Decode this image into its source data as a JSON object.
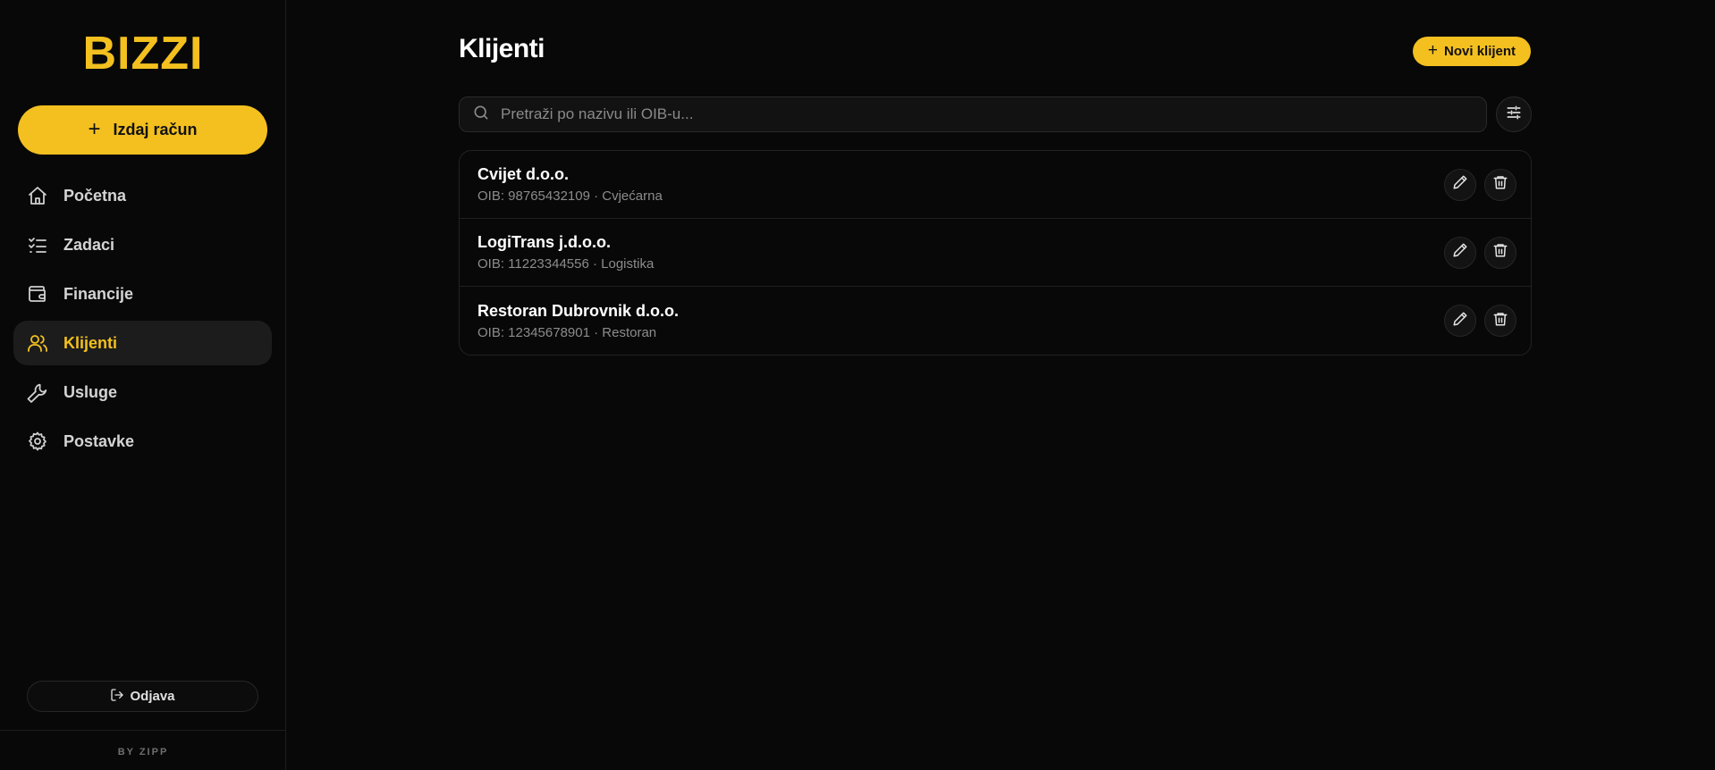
{
  "brand": {
    "logo_text": "BIZZI",
    "accent_color": "#f3c01f",
    "byline": "BY ZIPP"
  },
  "sidebar": {
    "cta_label": "Izdaj račun",
    "items": [
      {
        "label": "Početna",
        "icon": "home-icon",
        "active": false
      },
      {
        "label": "Zadaci",
        "icon": "checklist-icon",
        "active": false
      },
      {
        "label": "Financije",
        "icon": "wallet-icon",
        "active": false
      },
      {
        "label": "Klijenti",
        "icon": "users-icon",
        "active": true
      },
      {
        "label": "Usluge",
        "icon": "wrench-icon",
        "active": false
      },
      {
        "label": "Postavke",
        "icon": "gear-icon",
        "active": false
      }
    ],
    "logout_label": "Odjava"
  },
  "main": {
    "title": "Klijenti",
    "new_client_label": "Novi klijent",
    "search": {
      "value": "",
      "placeholder": "Pretraži po nazivu ili OIB-u..."
    },
    "clients": [
      {
        "name": "Cvijet d.o.o.",
        "meta": "OIB: 98765432109 · Cvjećarna"
      },
      {
        "name": "LogiTrans j.d.o.o.",
        "meta": "OIB: 11223344556 · Logistika"
      },
      {
        "name": "Restoran Dubrovnik d.o.o.",
        "meta": "OIB: 12345678901 · Restoran"
      }
    ]
  }
}
